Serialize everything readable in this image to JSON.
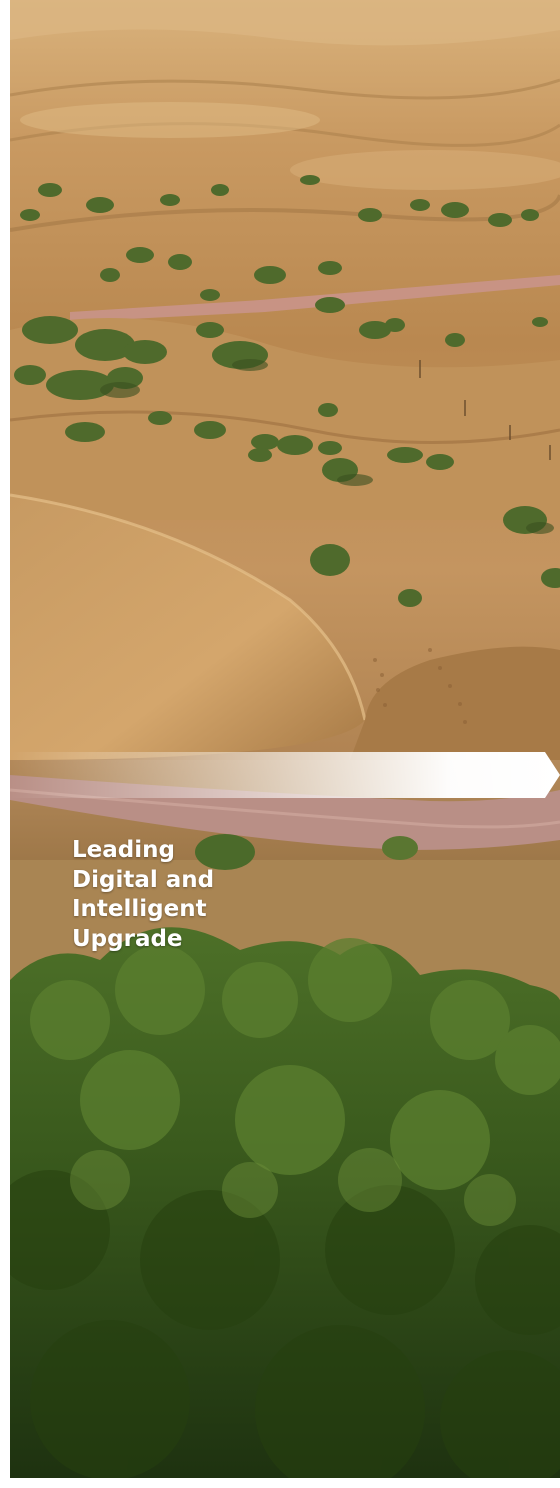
{
  "headline": {
    "line1": "Leading",
    "line2": "Digital and",
    "line3": "Intelligent",
    "line4": "Upgrade"
  },
  "colors": {
    "sand_light": "#d3aa74",
    "sand_mid": "#b88a53",
    "sand_dark": "#7d5a31",
    "road": "#bd8f86",
    "shrub": "#4e6a2d",
    "forest": "#2e4a17",
    "banner_white": "#ffffff"
  },
  "icons": {
    "banner": "arrow-banner-shape"
  }
}
